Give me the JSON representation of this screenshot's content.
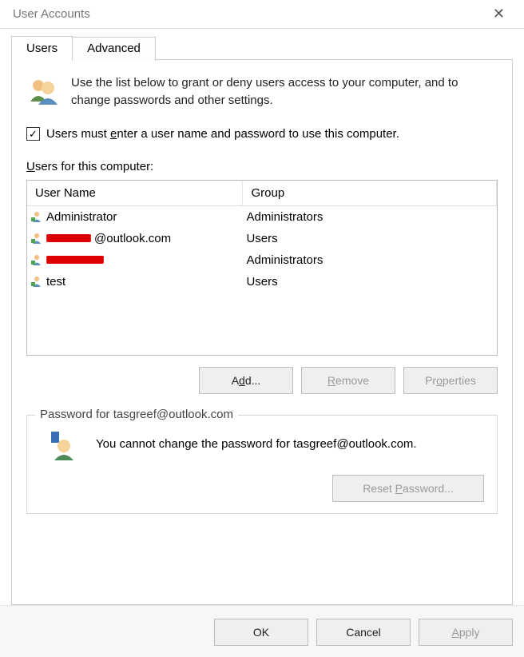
{
  "title": "User Accounts",
  "tabs": {
    "users": "Users",
    "advanced": "Advanced"
  },
  "intro": "Use the list below to grant or deny users access to your computer, and to change passwords and other settings.",
  "checkbox": {
    "checked": true,
    "label_pre": "Users must ",
    "label_u": "e",
    "label_post": "nter a user name and password to use this computer."
  },
  "users_label_pre": "",
  "users_label_u": "U",
  "users_label_post": "sers for this computer:",
  "columns": {
    "name": "User Name",
    "group": "Group"
  },
  "users": [
    {
      "name": "Administrator",
      "group": "Administrators",
      "redacted": false
    },
    {
      "name": "@outlook.com",
      "group": "Users",
      "redacted": true,
      "redact_w": 56
    },
    {
      "name": "",
      "group": "Administrators",
      "redacted": true,
      "redact_w": 72
    },
    {
      "name": "test",
      "group": "Users",
      "redacted": false
    }
  ],
  "buttons": {
    "add": "Add...",
    "add_u": "d",
    "remove": "Remove",
    "remove_u": "R",
    "properties": "Properties",
    "properties_u": "o"
  },
  "password_box": {
    "title": "Password for tasgreef@outlook.com",
    "message": "You cannot change the password for tasgreef@outlook.com.",
    "reset_btn": "Reset Password...",
    "reset_u": "P"
  },
  "footer": {
    "ok": "OK",
    "cancel": "Cancel",
    "apply": "Apply",
    "apply_u": "A"
  }
}
